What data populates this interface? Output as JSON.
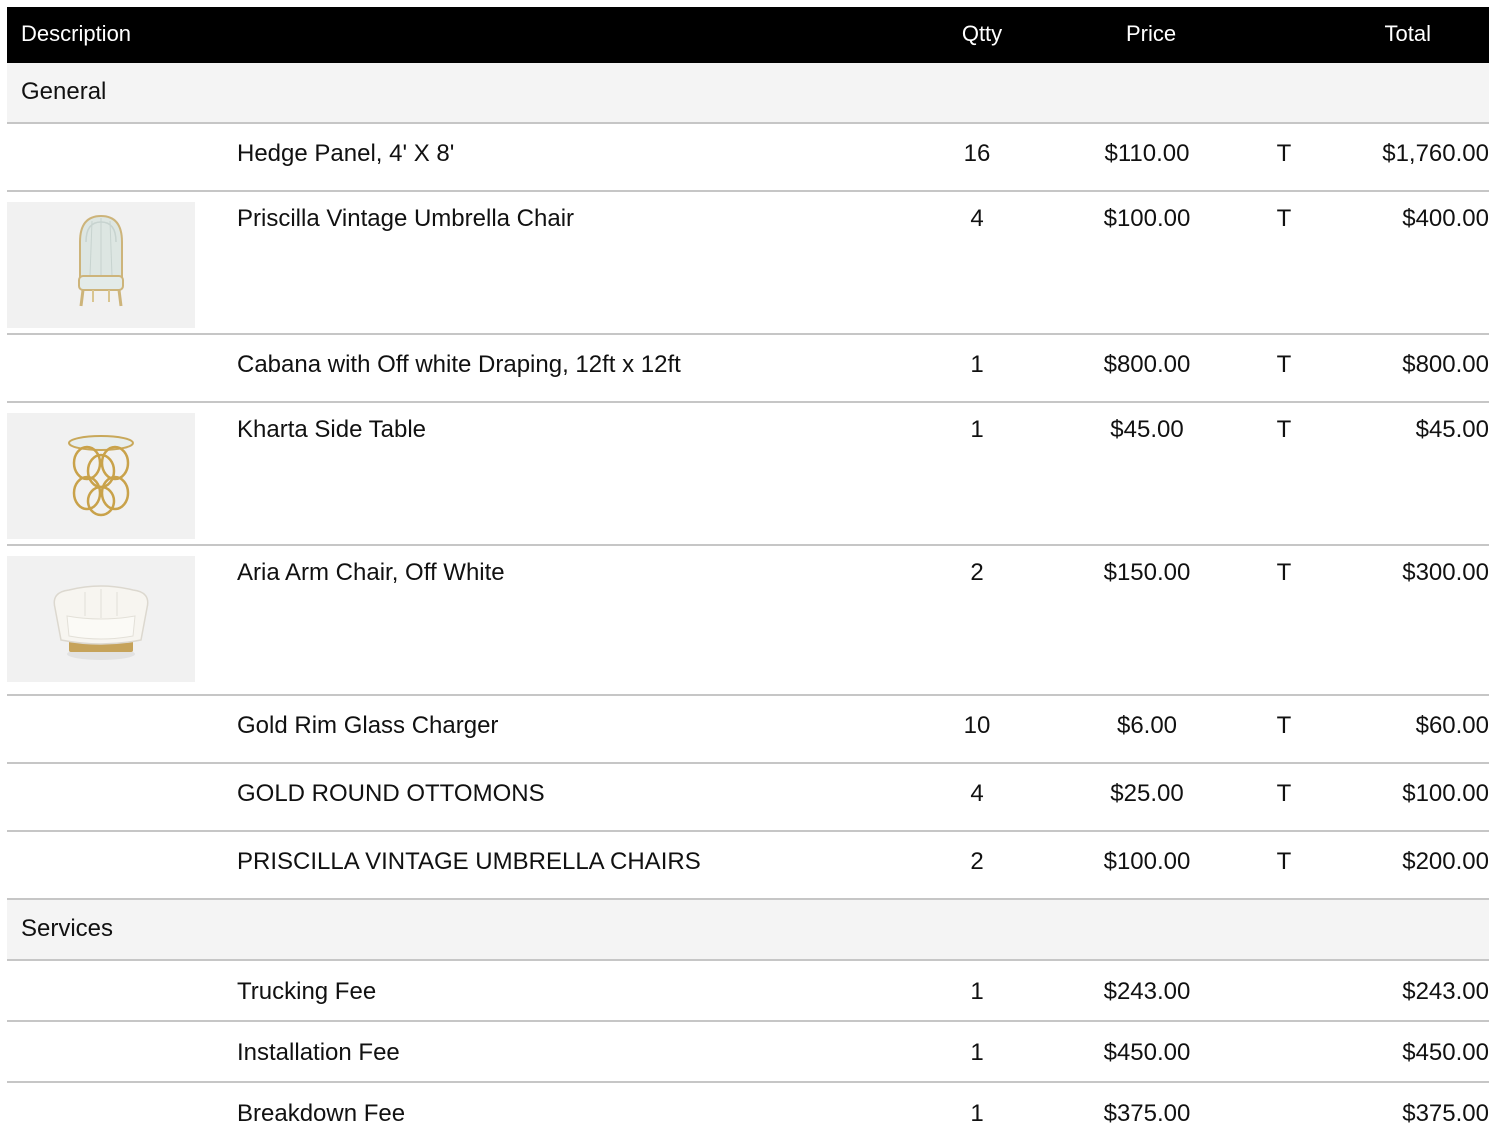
{
  "header": {
    "description": "Description",
    "qty": "Qtty",
    "price": "Price",
    "total": "Total"
  },
  "sections": [
    {
      "name": "General",
      "items": [
        {
          "description": "Hedge Panel, 4' X 8'",
          "qty": "16",
          "price": "$110.00",
          "tax": "T",
          "total": "$1,760.00",
          "image": null
        },
        {
          "description": "Priscilla Vintage Umbrella Chair",
          "qty": "4",
          "price": "$100.00",
          "tax": "T",
          "total": "$400.00",
          "image": "umbrella-chair-icon"
        },
        {
          "description": "Cabana with Off white Draping, 12ft x 12ft",
          "qty": "1",
          "price": "$800.00",
          "tax": "T",
          "total": "$800.00",
          "image": null
        },
        {
          "description": "Kharta Side Table",
          "qty": "1",
          "price": "$45.00",
          "tax": "T",
          "total": "$45.00",
          "image": "side-table-icon"
        },
        {
          "description": "Aria Arm Chair, Off White",
          "qty": "2",
          "price": "$150.00",
          "tax": "T",
          "total": "$300.00",
          "image": "arm-chair-icon"
        },
        {
          "description": "Gold Rim Glass Charger",
          "qty": "10",
          "price": "$6.00",
          "tax": "T",
          "total": "$60.00",
          "image": null
        },
        {
          "description": "GOLD ROUND OTTOMONS",
          "qty": "4",
          "price": "$25.00",
          "tax": "T",
          "total": "$100.00",
          "image": null
        },
        {
          "description": "PRISCILLA VINTAGE UMBRELLA CHAIRS",
          "qty": "2",
          "price": "$100.00",
          "tax": "T",
          "total": "$200.00",
          "image": null
        }
      ]
    },
    {
      "name": "Services",
      "items": [
        {
          "description": "Trucking Fee",
          "qty": "1",
          "price": "$243.00",
          "tax": "",
          "total": "$243.00",
          "image": null
        },
        {
          "description": "Installation Fee",
          "qty": "1",
          "price": "$450.00",
          "tax": "",
          "total": "$450.00",
          "image": null
        },
        {
          "description": "Breakdown Fee",
          "qty": "1",
          "price": "$375.00",
          "tax": "",
          "total": "$375.00",
          "image": null
        }
      ]
    }
  ]
}
